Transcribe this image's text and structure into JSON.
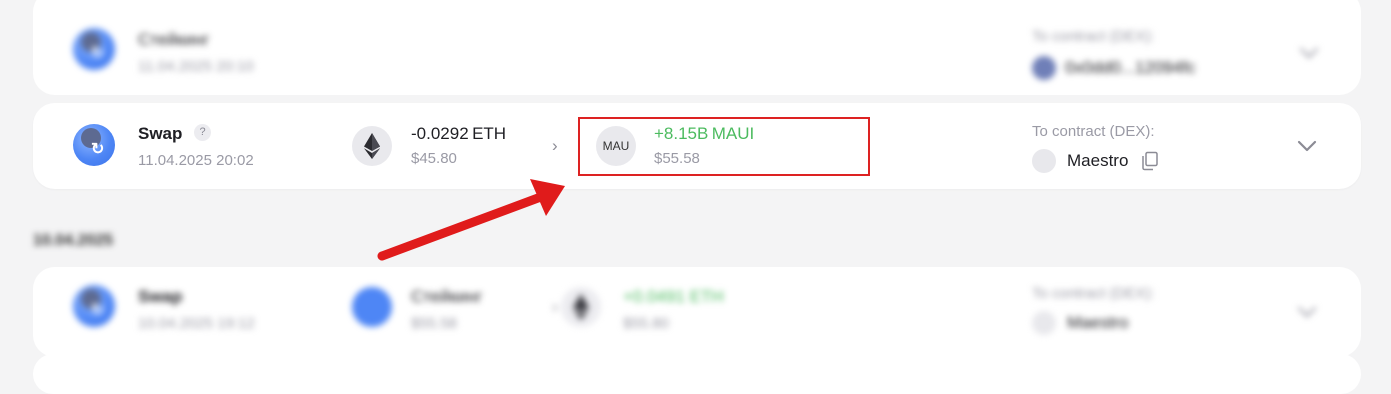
{
  "rows": {
    "top": {
      "title": "Стейкинг",
      "datetime": "11.04.2025 20:10",
      "to_label": "To contract (DEX):",
      "dex_name": "0x0dd0...12094fc"
    },
    "swap": {
      "title": "Swap",
      "help_symbol": "?",
      "datetime": "11.04.2025 20:02",
      "sent": {
        "amount": "-0.0292",
        "symbol": "ETH",
        "usd": "$45.80",
        "icon": "ethereum-icon"
      },
      "received": {
        "amount": "+8.15B",
        "symbol": "MAUI",
        "usd": "$55.58",
        "icon_label": "MAU"
      },
      "to_label": "To contract (DEX):",
      "dex_name": "Maestro",
      "highlighted_token": "MAUI"
    },
    "bottom": {
      "title": "Swap",
      "datetime": "10.04.2025 19:12",
      "sent": {
        "amount": "Стейкинг",
        "usd": "$55.58"
      },
      "received": {
        "amount": "+0.0491 ETH",
        "usd": "$55.80"
      },
      "to_label": "To contract (DEX):",
      "dex_name": "Maestro"
    }
  },
  "day_header": "10.04.2025",
  "colors": {
    "positive": "#4cbb5f",
    "highlight_border": "#dd2222",
    "arrow": "#e01b1b",
    "swap_icon": "#4e86f5"
  }
}
